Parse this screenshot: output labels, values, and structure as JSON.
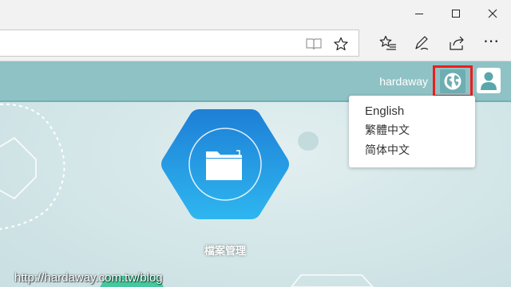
{
  "window_controls": {
    "minimize_icon": "minimize-icon",
    "maximize_icon": "maximize-icon",
    "close_icon": "close-icon"
  },
  "toolbar": {
    "icons": [
      "reading-view-icon",
      "favorite-star-icon",
      "favorites-hub-icon",
      "web-note-icon",
      "share-icon",
      "more-icon"
    ],
    "more_label": "⋯"
  },
  "header": {
    "username": "hardaway",
    "language_icon": "globe-icon",
    "user_icon": "user-icon"
  },
  "language_menu": {
    "items": [
      "English",
      "繁體中文",
      "简体中文"
    ]
  },
  "apps": [
    {
      "label": "檔案管理",
      "icon": "folder-icon"
    }
  ],
  "watermark": "http://hardaway.com.tw/blog",
  "colors": {
    "header": "#8fc2c5",
    "highlight": "#ee1c1c",
    "app_blue_top": "#1e7fd6",
    "app_blue_bottom": "#2eb6f0"
  }
}
